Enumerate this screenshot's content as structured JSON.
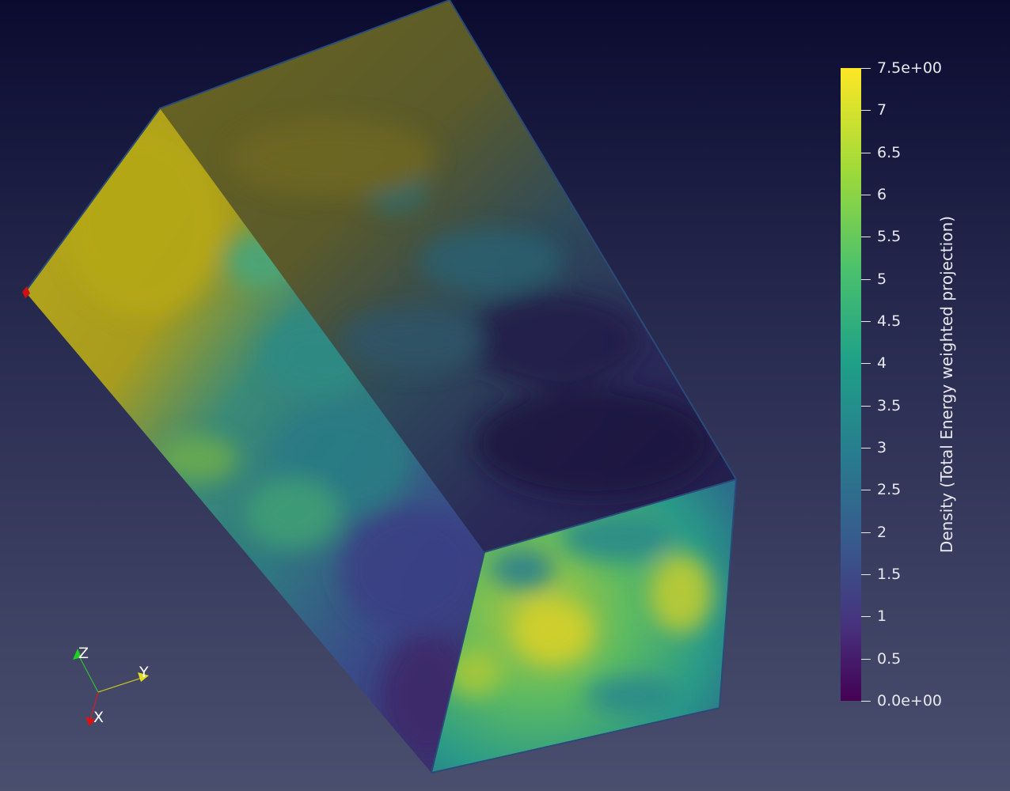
{
  "colorbar": {
    "title": "Density (Total Energy weighted projection)",
    "max_label": "7.5e+00",
    "min_label": "0.0e+00",
    "ticks": [
      {
        "value": 7.5,
        "label": "7.5e+00"
      },
      {
        "value": 7,
        "label": "7"
      },
      {
        "value": 6.5,
        "label": "6.5"
      },
      {
        "value": 6,
        "label": "6"
      },
      {
        "value": 5.5,
        "label": "5.5"
      },
      {
        "value": 5,
        "label": "5"
      },
      {
        "value": 4.5,
        "label": "4.5"
      },
      {
        "value": 4,
        "label": "4"
      },
      {
        "value": 3.5,
        "label": "3.5"
      },
      {
        "value": 3,
        "label": "3"
      },
      {
        "value": 2.5,
        "label": "2.5"
      },
      {
        "value": 2,
        "label": "2"
      },
      {
        "value": 1.5,
        "label": "1.5"
      },
      {
        "value": 1,
        "label": "1"
      },
      {
        "value": 0.5,
        "label": "0.5"
      },
      {
        "value": 0,
        "label": "0.0e+00"
      }
    ],
    "range": [
      0,
      7.5
    ],
    "colormap": "viridis",
    "colors": [
      "#440154",
      "#3b528b",
      "#21918c",
      "#5ec962",
      "#fde725"
    ]
  },
  "axes": {
    "x_label": "X",
    "y_label": "Y",
    "z_label": "Z",
    "x_color": "#e01010",
    "y_color": "#e0e020",
    "z_color": "#20d020"
  },
  "background": {
    "top_color": "#0b0b30",
    "bottom_color": "#4a4f6e"
  }
}
